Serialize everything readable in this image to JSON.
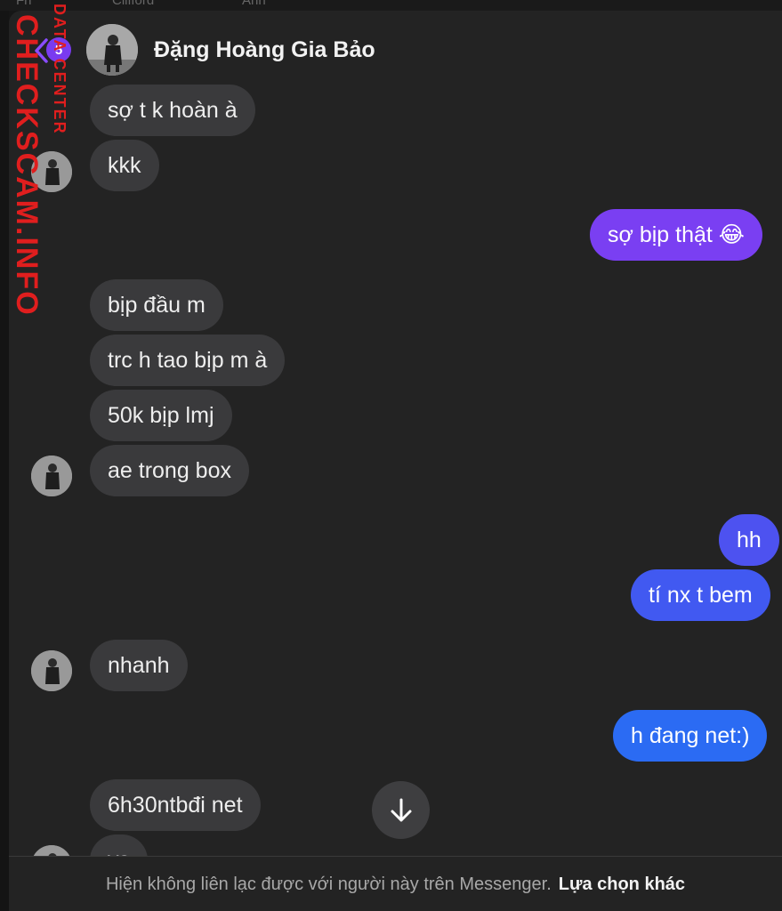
{
  "background": {
    "tab_labels": [
      "Fri",
      "Clifford",
      "Anh"
    ]
  },
  "header": {
    "back_badge": "5",
    "contact_name": "Đặng Hoàng Gia Bảo"
  },
  "messages": [
    {
      "text": "sợ t k hoàn à",
      "side": "in"
    },
    {
      "text": "kkk",
      "side": "in"
    },
    {
      "text": "sợ bịp thật 😂",
      "side": "out"
    },
    {
      "text": "bịp đầu m",
      "side": "in"
    },
    {
      "text": "trc h tao bịp m à",
      "side": "in"
    },
    {
      "text": "50k bịp lmj",
      "side": "in"
    },
    {
      "text": "ae trong box",
      "side": "in"
    },
    {
      "text": "hh",
      "side": "out"
    },
    {
      "text": "tí nx t bem",
      "side": "out"
    },
    {
      "text": "nhanh",
      "side": "in"
    },
    {
      "text": "h đang net:)",
      "side": "out"
    },
    {
      "text": "6h30ntbđi net",
      "side": "in"
    },
    {
      "text": "vs",
      "side": "in"
    }
  ],
  "footer": {
    "notice": "Hiện không liên lạc được với người này trên Messenger.",
    "action": "Lựa chọn khác"
  },
  "watermark": {
    "main": "CHECKSCAM.INFO",
    "sub": "DATA CENTER"
  },
  "colors": {
    "accent_purple": "#7a3bf0",
    "accent_blue": "#2b6bf3",
    "incoming_bubble": "#3a3a3c",
    "watermark_red": "#e01e1e"
  }
}
